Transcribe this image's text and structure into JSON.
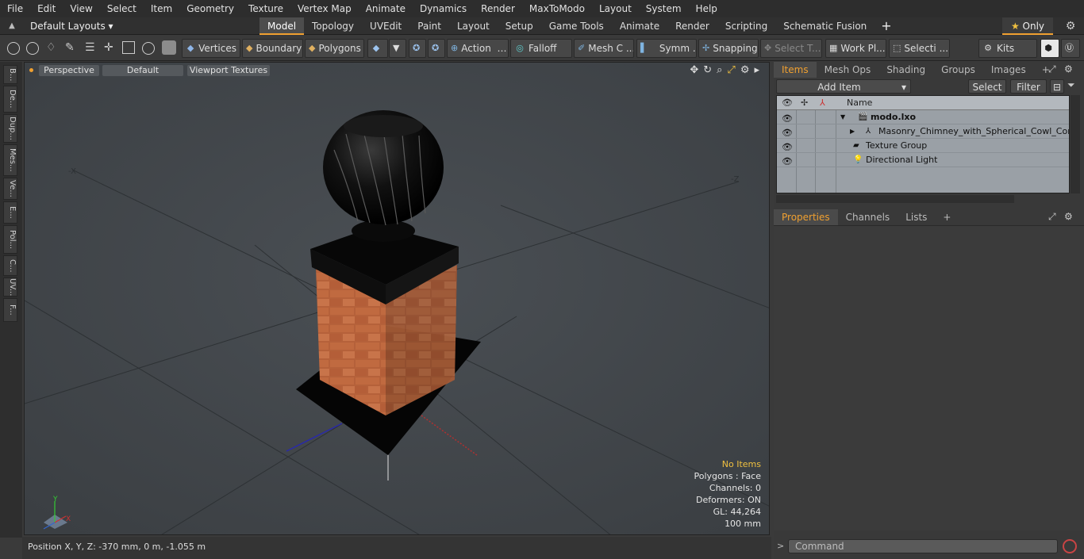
{
  "menu": [
    "File",
    "Edit",
    "View",
    "Select",
    "Item",
    "Geometry",
    "Texture",
    "Vertex Map",
    "Animate",
    "Dynamics",
    "Render",
    "MaxToModo",
    "Layout",
    "System",
    "Help"
  ],
  "layout_bar": {
    "default_layouts": "Default Layouts ▾",
    "tabs": [
      "Model",
      "Topology",
      "UVEdit",
      "Paint",
      "Layout",
      "Setup",
      "Game Tools",
      "Animate",
      "Render",
      "Scripting",
      "Schematic Fusion"
    ],
    "active_tab": "Model",
    "add": "+",
    "only_label": "Only"
  },
  "toolbar": {
    "vertices": "Vertices",
    "boundary": "Boundary",
    "polygons": "Polygons",
    "action": "Action",
    "falloff": "Falloff",
    "mesh": "Mesh C ...",
    "symm": "Symm ...",
    "snapping": "Snapping",
    "select_t": "Select T...",
    "work_pl": "Work Pl...",
    "selecti": "Selecti ...",
    "kits": "Kits"
  },
  "left_strip": [
    "B...",
    "De...",
    "Dup...",
    "Mes...",
    "Ve...",
    "E...",
    "Pol...",
    "C...",
    "UV...",
    "F..."
  ],
  "viewport": {
    "perspective": "Perspective",
    "default": "Default",
    "viewport_textures": "Viewport Textures",
    "axis_neg_x": "-X",
    "axis_neg_z": "-Z",
    "info": {
      "no_items": "No Items",
      "polygons": "Polygons : Face",
      "channels": "Channels: 0",
      "deformers": "Deformers: ON",
      "gl": "GL: 44,264",
      "scale": "100 mm"
    },
    "gizmo": {
      "y": "Y",
      "x": "X"
    }
  },
  "status": {
    "position": "Position X, Y, Z:   -370 mm, 0 m, -1.055 m"
  },
  "right_panel": {
    "tabs": [
      "Items",
      "Mesh Ops",
      "Shading",
      "Groups",
      "Images"
    ],
    "active_tab": "Items",
    "add_item": "Add Item",
    "select": "Select",
    "filter": "Filter",
    "tree_header": "Name",
    "tree_rows": [
      {
        "label": "modo.lxo",
        "bold": true
      },
      {
        "label": "Masonry_Chimney_with_Spherical_Cowl_Corne ..."
      },
      {
        "label": "Texture Group"
      },
      {
        "label": "Directional Light"
      }
    ],
    "props_tabs": [
      "Properties",
      "Channels",
      "Lists"
    ],
    "props_active": "Properties",
    "command_placeholder": "Command"
  }
}
